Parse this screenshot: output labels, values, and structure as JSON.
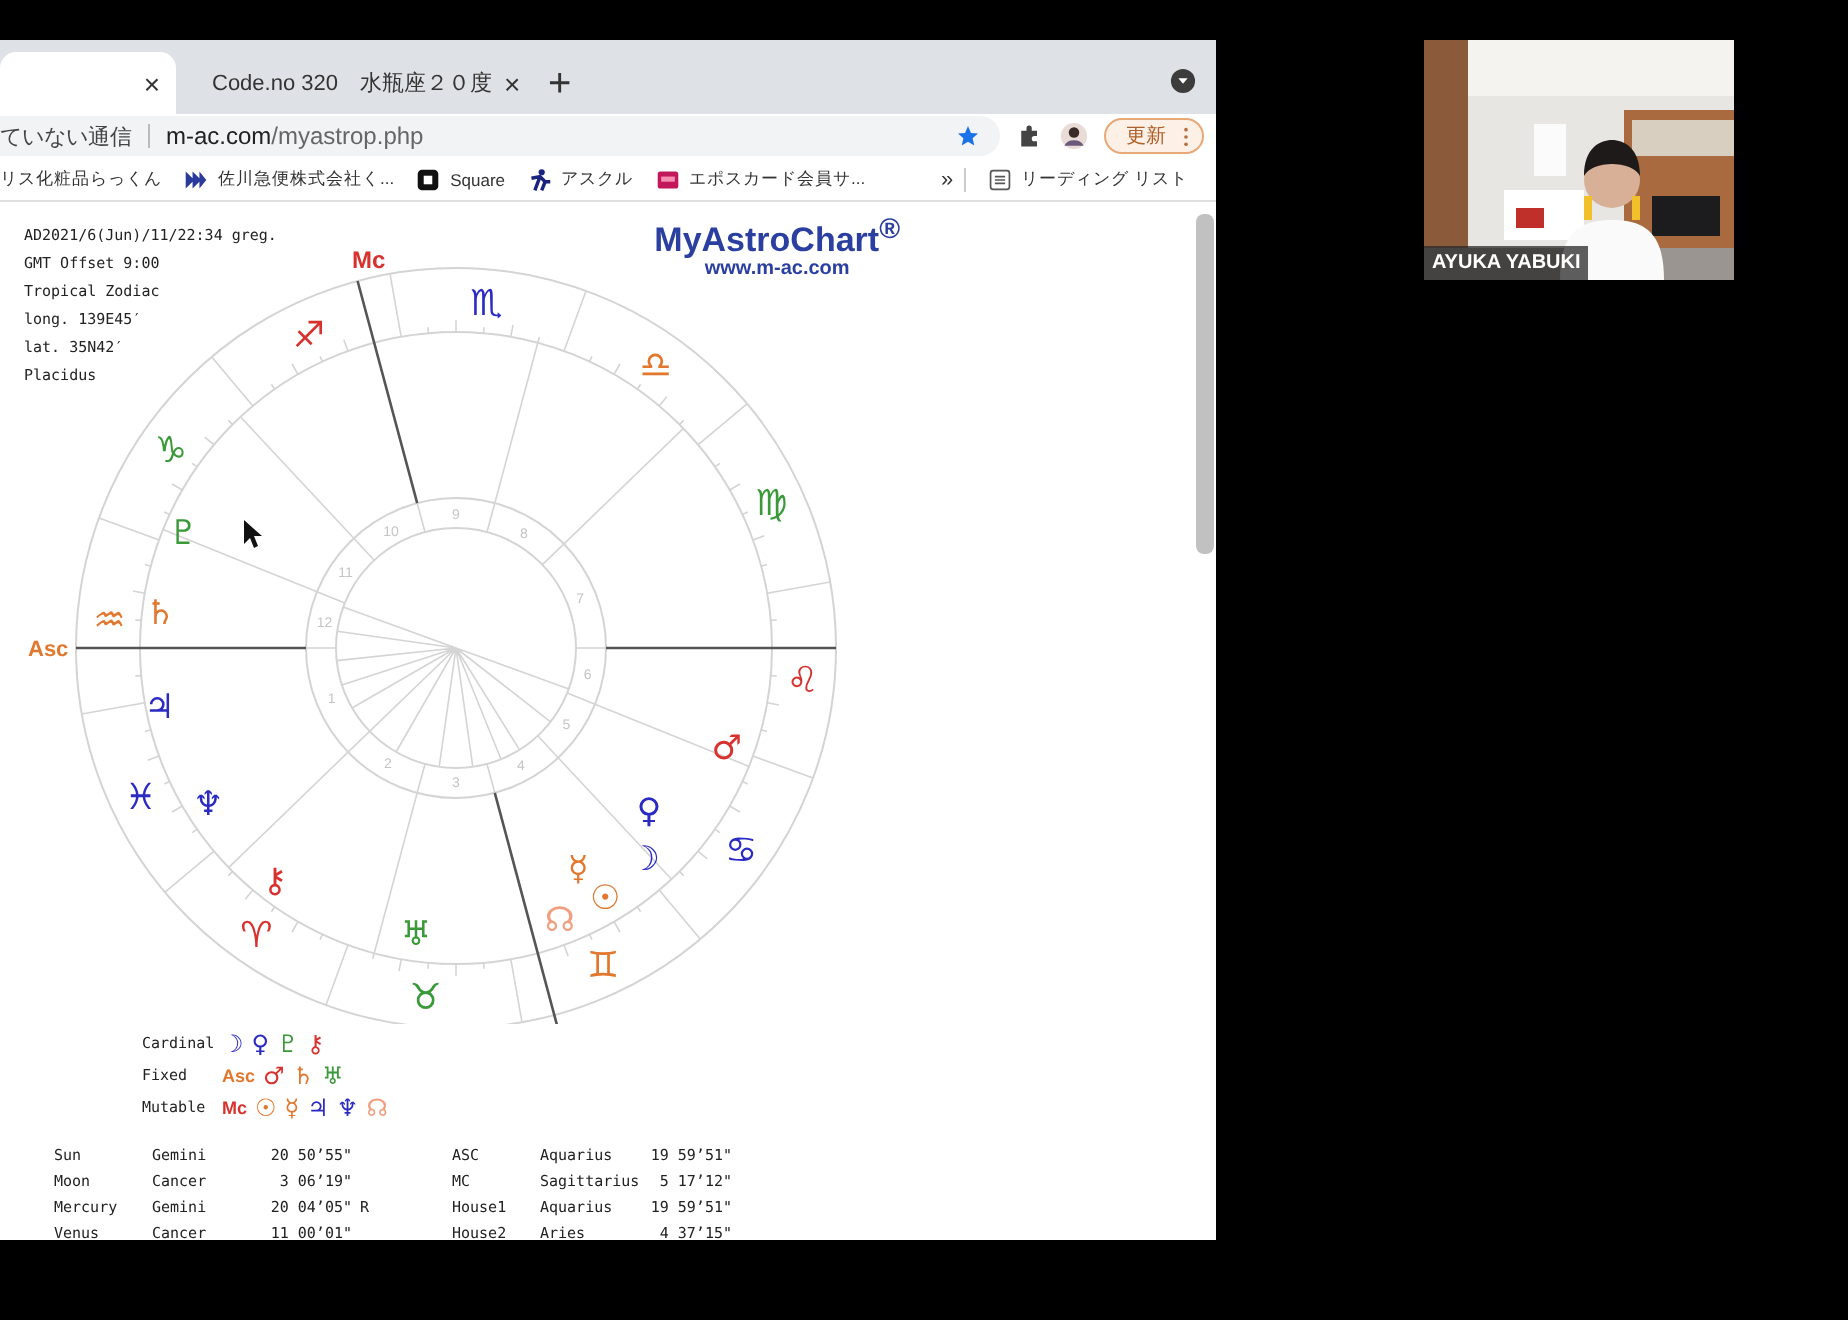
{
  "browser": {
    "tabs": [
      {
        "close": "×",
        "selected": true
      },
      {
        "title": "Code.no 320　水瓶座２０度",
        "close": "×",
        "selected": false
      }
    ],
    "new_tab": "+",
    "address": {
      "security_label": "ていない通信",
      "url_host": "m-ac.com",
      "url_path": "/myastrop.php"
    },
    "update_button": "更新",
    "bookmarks": [
      {
        "label": "リス化粧品らっくん",
        "kind": "none"
      },
      {
        "label": "佐川急便株式会社く...",
        "kind": "stripes"
      },
      {
        "label": "Square",
        "kind": "square"
      },
      {
        "label": "アスクル",
        "kind": "runner"
      },
      {
        "label": "エポスカード会員サ...",
        "kind": "card"
      }
    ],
    "bookmarks_more": "»",
    "reading_list": "リーディング リスト"
  },
  "page": {
    "chart_info": [
      "AD2021/6(Jun)/11/22:34 greg.",
      "GMT Offset 9:00",
      "Tropical Zodiac",
      "long. 139E45′",
      "lat. 35N42′",
      "Placidus"
    ],
    "logo": "MyAstroChart$^{®}$",
    "logo_url": "www.m-ac.com",
    "wheel": {
      "mc_label": "Mc",
      "asc_label": "Asc",
      "signs": [
        {
          "glyph": "♈",
          "color": "#d8322e"
        },
        {
          "glyph": "♉",
          "color": "#3a9a3a"
        },
        {
          "glyph": "♊",
          "color": "#e2772e"
        },
        {
          "glyph": "♋",
          "color": "#2b2bc4"
        },
        {
          "glyph": "♌",
          "color": "#d8322e"
        },
        {
          "glyph": "♍",
          "color": "#3a9a3a"
        },
        {
          "glyph": "♎",
          "color": "#e2772e"
        },
        {
          "glyph": "♏",
          "color": "#2b2bc4"
        },
        {
          "glyph": "♐",
          "color": "#d8322e"
        },
        {
          "glyph": "♑",
          "color": "#3a9a3a"
        },
        {
          "glyph": "♒",
          "color": "#e2772e"
        },
        {
          "glyph": "♓",
          "color": "#2b2bc4"
        }
      ],
      "house_numbers": [
        "1",
        "2",
        "3",
        "4",
        "5",
        "6",
        "7",
        "8",
        "9",
        "10",
        "11",
        "12"
      ],
      "planets": [
        {
          "glyph": "☉",
          "color": "#e2772e"
        },
        {
          "glyph": "☽",
          "color": "#2b2bc4"
        },
        {
          "glyph": "☿",
          "color": "#e2772e"
        },
        {
          "glyph": "♀",
          "color": "#2b2bc4"
        },
        {
          "glyph": "♂",
          "color": "#d8322e"
        },
        {
          "glyph": "♃",
          "color": "#2b2bc4"
        },
        {
          "glyph": "♄",
          "color": "#e2772e"
        },
        {
          "glyph": "♅",
          "color": "#3a9a3a"
        },
        {
          "glyph": "♆",
          "color": "#2b2bc4"
        },
        {
          "glyph": "♇",
          "color": "#3a9a3a"
        },
        {
          "glyph": "⚷",
          "color": "#d8322e"
        },
        {
          "glyph": "☊",
          "color": "#f0a080"
        }
      ]
    },
    "modalities": [
      {
        "label": "Cardinal",
        "glyphs": [
          {
            "glyph": "☽",
            "color": "#2b2bc4"
          },
          {
            "glyph": "♀",
            "color": "#2b2bc4"
          },
          {
            "glyph": "♇",
            "color": "#3a9a3a"
          },
          {
            "glyph": "⚷",
            "color": "#d8322e"
          }
        ]
      },
      {
        "label": "Fixed",
        "glyphs": [
          {
            "glyph": "Asc",
            "color": "#e2772e"
          },
          {
            "glyph": "♂",
            "color": "#d8322e"
          },
          {
            "glyph": "♄",
            "color": "#e2772e"
          },
          {
            "glyph": "♅",
            "color": "#3a9a3a"
          }
        ]
      },
      {
        "label": "Mutable",
        "glyphs": [
          {
            "glyph": "Mc",
            "color": "#d8322e"
          },
          {
            "glyph": "☉",
            "color": "#e2772e"
          },
          {
            "glyph": "☿",
            "color": "#e2772e"
          },
          {
            "glyph": "♃",
            "color": "#2b2bc4"
          },
          {
            "glyph": "♆",
            "color": "#2b2bc4"
          },
          {
            "glyph": "☊",
            "color": "#f0a080"
          }
        ]
      }
    ],
    "planet_positions": [
      {
        "body": "Sun",
        "sign": "Gemini",
        "degree": "20 50’55\""
      },
      {
        "body": "Moon",
        "sign": "Cancer",
        "degree": "3 06’19\""
      },
      {
        "body": "Mercury",
        "sign": "Gemini",
        "degree": "20 04’05\"",
        "flag": "R"
      },
      {
        "body": "Venus",
        "sign": "Cancer",
        "degree": "11 00’01\""
      }
    ],
    "angle_positions": [
      {
        "body": "ASC",
        "sign": "Aquarius",
        "degree": "19 59’51\""
      },
      {
        "body": "MC",
        "sign": "Sagittarius",
        "degree": "5 17’12\""
      },
      {
        "body": "House1",
        "sign": "Aquarius",
        "degree": "19 59’51\""
      },
      {
        "body": "House2",
        "sign": "Aries",
        "degree": "4 37’15\""
      }
    ]
  },
  "video": {
    "name": "AYUKA YABUKI"
  }
}
